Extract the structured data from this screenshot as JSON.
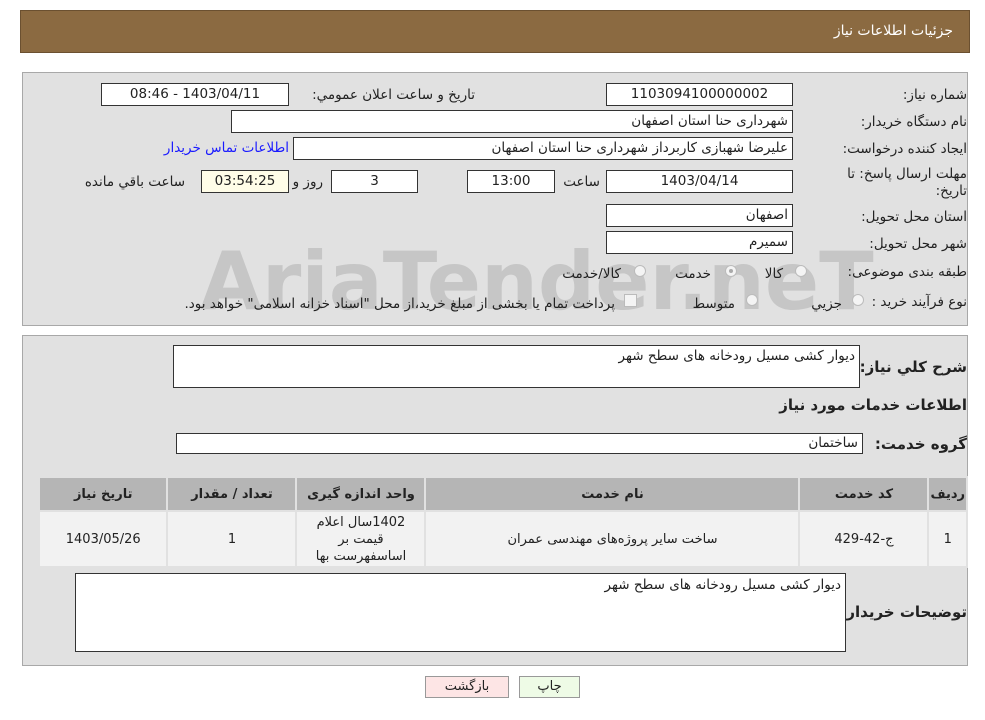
{
  "header": {
    "title": "جزئیات اطلاعات نیاز"
  },
  "fields": {
    "need_number_label": "شماره نیاز:",
    "need_number": "1103094100000002",
    "announce_label": "تاریخ و ساعت اعلان عمومي:",
    "announce_value": "1403/04/11 - 08:46",
    "buyer_label": "نام دستگاه خریدار:",
    "buyer_value": "شهرداری حنا استان اصفهان",
    "creator_label": "ایجاد کننده درخواست:",
    "creator_value": "علیرضا شهبازی کاربرداز شهرداری حنا استان اصفهان",
    "contact_link": "اطلاعات تماس خریدار",
    "deadline_label": "مهلت ارسال پاسخ: تا تاریخ:",
    "deadline_date": "1403/04/14",
    "time_label": "ساعت",
    "deadline_time": "13:00",
    "days": "3",
    "days_label": "روز و",
    "remaining": "03:54:25",
    "remaining_label": "ساعت باقي مانده",
    "province_label": "استان محل تحویل:",
    "province": "اصفهان",
    "city_label": "شهر محل تحویل:",
    "city": "سمیرم",
    "category_label": "طبقه بندی موضوعی:",
    "category_options": [
      "کالا",
      "خدمت",
      "کالا/خدمت"
    ],
    "category_selected": "خدمت",
    "process_label": "نوع فرآیند خرید :",
    "process_options": [
      "جزيي",
      "متوسط"
    ],
    "payment_note": "پرداخت تمام یا بخشی از مبلغ خرید،از محل \"اسناد خزانه اسلامی\" خواهد بود."
  },
  "details": {
    "summary_label": "شرح کلي نياز:",
    "summary": "دیوار کشی مسیل رودخانه های سطح شهر",
    "services_title": "اطلاعات خدمات مورد نياز",
    "group_label": "گروه خدمت:",
    "group": "ساختمان",
    "table": {
      "headers": [
        "ردیف",
        "کد خدمت",
        "نام خدمت",
        "واحد اندازه گیری",
        "تعداد / مقدار",
        "تاریخ نیاز"
      ],
      "rows": [
        [
          "1",
          "ج-42-429",
          "ساخت سایر پروژه‌های مهندسی عمران",
          "1402سال اعلام قیمت بر اساسفهرست بها",
          "1",
          "1403/05/26"
        ]
      ]
    },
    "buyer_notes_label": "توضیحات خریدار:",
    "buyer_notes": "دیوار کشی مسیل رودخانه های سطح شهر"
  },
  "buttons": {
    "print": "چاپ",
    "back": "بازگشت"
  },
  "watermark": "AriaTender.neT"
}
